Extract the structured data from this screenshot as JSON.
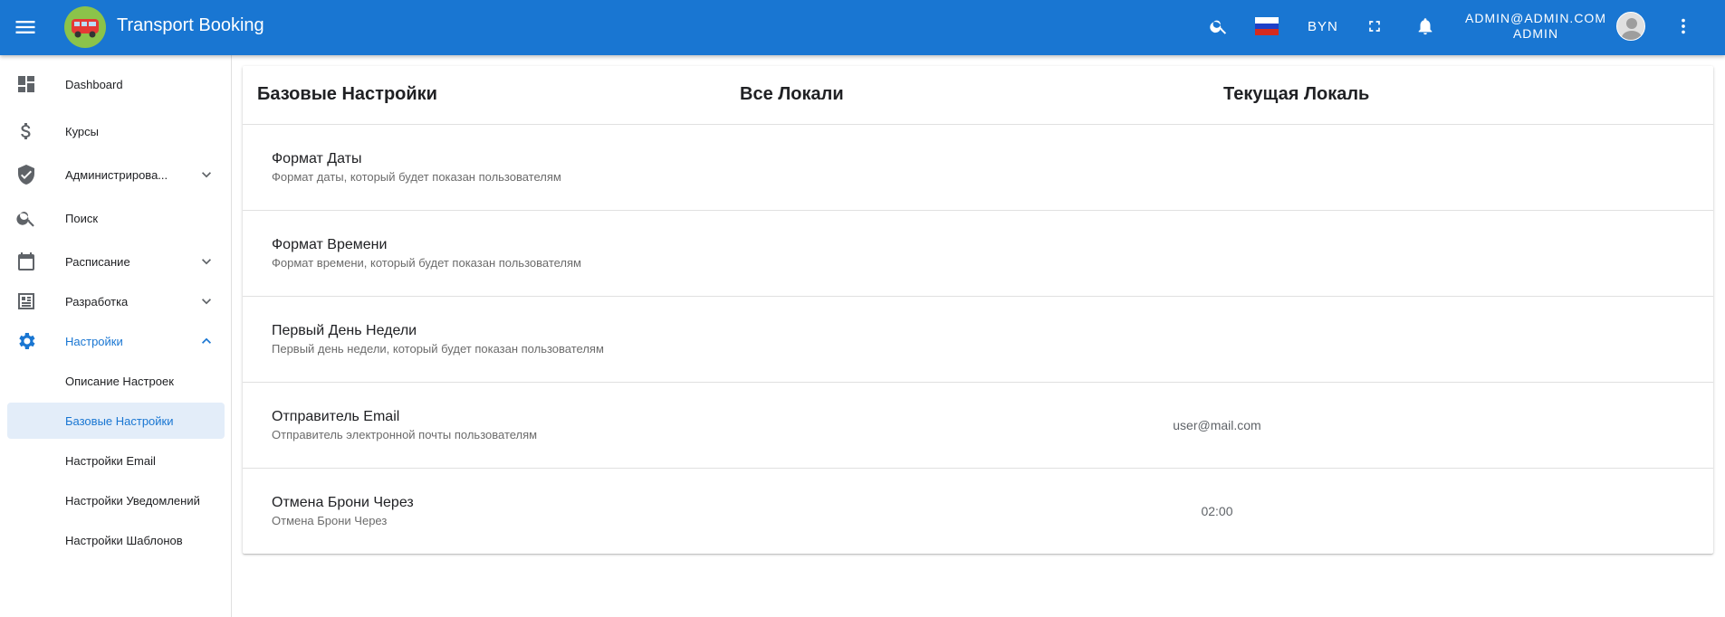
{
  "header": {
    "app_title": "Transport Booking",
    "currency": "BYN",
    "user_email": "ADMIN@ADMIN.COM",
    "user_role": "ADMIN",
    "icons": [
      "menu-icon",
      "search-icon",
      "russia-flag-icon",
      "fullscreen-icon",
      "bell-icon",
      "more-vert-icon"
    ],
    "colors": {
      "primary": "#1976d2"
    }
  },
  "sidebar": {
    "items": [
      {
        "label": "Dashboard",
        "icon": "dashboard-icon"
      },
      {
        "label": "Курсы",
        "icon": "dollar-icon"
      },
      {
        "label": "Администрирова...",
        "icon": "shield-icon"
      },
      {
        "label": "Поиск",
        "icon": "search-icon"
      },
      {
        "label": "Расписание",
        "icon": "calendar-icon"
      },
      {
        "label": "Разработка",
        "icon": "dev-icon"
      },
      {
        "label": "Настройки",
        "icon": "gear-icon"
      }
    ],
    "sub_items": [
      {
        "label": "Описание Настроек"
      },
      {
        "label": "Базовые Настройки"
      },
      {
        "label": "Настройки Email"
      },
      {
        "label": "Настройки Уведомлений"
      },
      {
        "label": "Настройки Шаблонов"
      }
    ]
  },
  "main": {
    "columns": [
      "Базовые Настройки",
      "Все Локали",
      "Текущая Локаль"
    ],
    "rows": [
      {
        "title": "Формат Даты",
        "description": "Формат даты, который будет показан пользователям",
        "value": ""
      },
      {
        "title": "Формат Времени",
        "description": "Формат времени, который будет показан пользователям",
        "value": ""
      },
      {
        "title": "Первый День Недели",
        "description": "Первый день недели, который будет показан пользователям",
        "value": ""
      },
      {
        "title": "Отправитель Email",
        "description": "Отправитель электронной почты пользователям",
        "value": "user@mail.com"
      },
      {
        "title": "Отмена Брони Через",
        "description": "Отмена Брони Через",
        "value": "02:00"
      }
    ]
  }
}
